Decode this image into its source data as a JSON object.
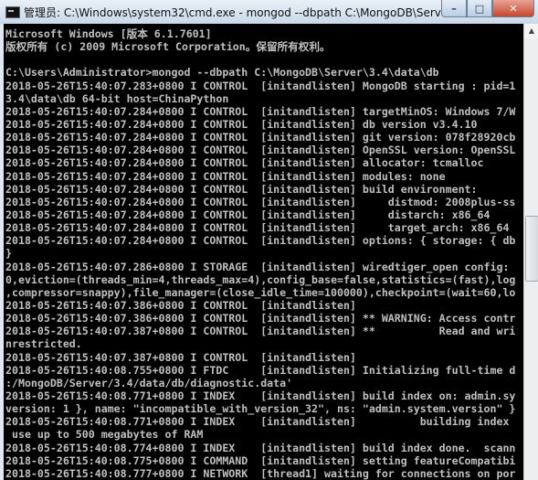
{
  "window": {
    "title": "管理员: C:\\Windows\\system32\\cmd.exe - mongod  --dbpath C:\\MongoDB\\Server\\3.4\\data\\...",
    "icon": "cmd-icon",
    "controls": {
      "minimize": "–",
      "maximize": "□",
      "close": "✕"
    }
  },
  "console": {
    "background": "#000000",
    "foreground": "#c0c0c0",
    "lines": [
      "Microsoft Windows [版本 6.1.7601]",
      "版权所有 (c) 2009 Microsoft Corporation。保留所有权利。",
      "",
      "C:\\Users\\Administrator>mongod --dbpath C:\\MongoDB\\Server\\3.4\\data\\db",
      "2018-05-26T15:40:07.283+0800 I CONTROL  [initandlisten] MongoDB starting : pid=1",
      "3.4\\data\\db 64-bit host=ChinaPython",
      "2018-05-26T15:40:07.284+0800 I CONTROL  [initandlisten] targetMinOS: Windows 7/W",
      "2018-05-26T15:40:07.284+0800 I CONTROL  [initandlisten] db version v3.4.10",
      "2018-05-26T15:40:07.284+0800 I CONTROL  [initandlisten] git version: 078f28920cb",
      "2018-05-26T15:40:07.284+0800 I CONTROL  [initandlisten] OpenSSL version: OpenSSL",
      "2018-05-26T15:40:07.284+0800 I CONTROL  [initandlisten] allocator: tcmalloc",
      "2018-05-26T15:40:07.284+0800 I CONTROL  [initandlisten] modules: none",
      "2018-05-26T15:40:07.284+0800 I CONTROL  [initandlisten] build environment:",
      "2018-05-26T15:40:07.284+0800 I CONTROL  [initandlisten]     distmod: 2008plus-ss",
      "2018-05-26T15:40:07.284+0800 I CONTROL  [initandlisten]     distarch: x86_64",
      "2018-05-26T15:40:07.284+0800 I CONTROL  [initandlisten]     target_arch: x86_64",
      "2018-05-26T15:40:07.284+0800 I CONTROL  [initandlisten] options: { storage: { db",
      "}",
      "2018-05-26T15:40:07.286+0800 I STORAGE  [initandlisten] wiredtiger_open config:",
      "0,eviction=(threads_min=4,threads_max=4),config_base=false,statistics=(fast),log",
      ",compressor=snappy),file_manager=(close_idle_time=100000),checkpoint=(wait=60,lo",
      "2018-05-26T15:40:07.386+0800 I CONTROL  [initandlisten]",
      "2018-05-26T15:40:07.386+0800 I CONTROL  [initandlisten] ** WARNING: Access contr",
      "2018-05-26T15:40:07.387+0800 I CONTROL  [initandlisten] **          Read and wri",
      "nrestricted.",
      "2018-05-26T15:40:07.387+0800 I CONTROL  [initandlisten]",
      "2018-05-26T15:40:08.755+0800 I FTDC     [initandlisten] Initializing full-time d",
      ":/MongoDB/Server/3.4/data/db/diagnostic.data'",
      "2018-05-26T15:40:08.771+0800 I INDEX    [initandlisten] build index on: admin.sy",
      "version: 1 }, name: \"incompatible_with_version_32\", ns: \"admin.system.version\" }",
      "2018-05-26T15:40:08.771+0800 I INDEX    [initandlisten]          building index",
      " use up to 500 megabytes of RAM",
      "2018-05-26T15:40:08.774+0800 I INDEX    [initandlisten] build index done.  scann",
      "2018-05-26T15:40:08.775+0800 I COMMAND  [initandlisten] setting featureCompatibi",
      "2018-05-26T15:40:08.777+0800 I NETWORK  [thread1] waiting for connections on por"
    ]
  },
  "scrollbar": {
    "up_arrow": "▲"
  }
}
